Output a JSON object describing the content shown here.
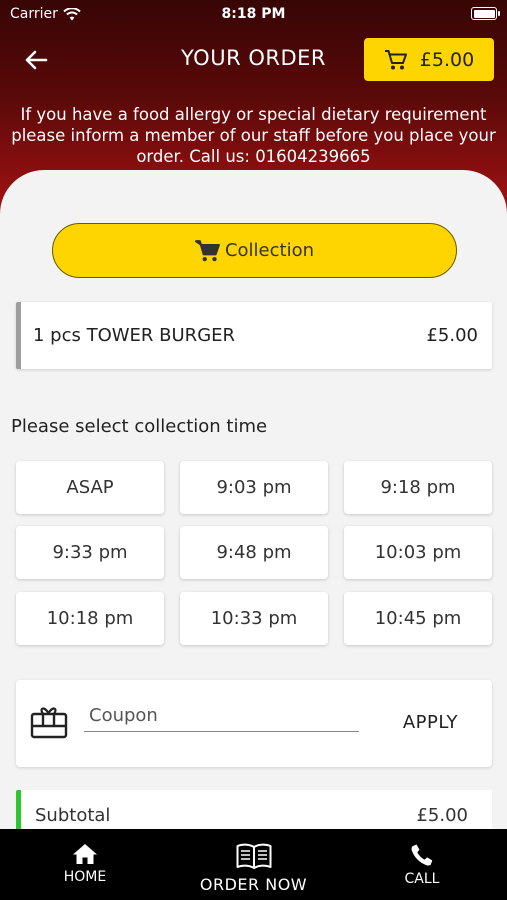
{
  "status": {
    "carrier": "Carrier",
    "time": "8:18 PM"
  },
  "header": {
    "title": "YOUR ORDER",
    "cart_total": "£5.00",
    "notice": "If you have a food allergy or special dietary requirement please inform a member of our staff before you place your order. Call us: 01604239665"
  },
  "order": {
    "mode_label": "Collection",
    "item": {
      "label": "1 pcs TOWER BURGER",
      "price": "£5.00"
    }
  },
  "collection": {
    "label": "Please select collection time",
    "slots": [
      "ASAP",
      "9:03 pm",
      "9:18 pm",
      "9:33 pm",
      "9:48 pm",
      "10:03 pm",
      "10:18 pm",
      "10:33 pm",
      "10:45 pm"
    ]
  },
  "coupon": {
    "placeholder": "Coupon",
    "apply_label": "APPLY"
  },
  "summary": {
    "subtotal_label": "Subtotal",
    "subtotal_value": "£5.00"
  },
  "nav": {
    "home": "HOME",
    "order_now": "ORDER NOW",
    "call": "CALL"
  },
  "colors": {
    "accent": "#ffd500",
    "header_dark": "#380505",
    "header_red": "#a41212",
    "success": "#2ec62e"
  },
  "icons": [
    "wifi-icon",
    "battery-icon",
    "back-arrow-icon",
    "cart-icon",
    "gift-card-icon",
    "home-icon",
    "menu-book-icon",
    "phone-icon"
  ]
}
